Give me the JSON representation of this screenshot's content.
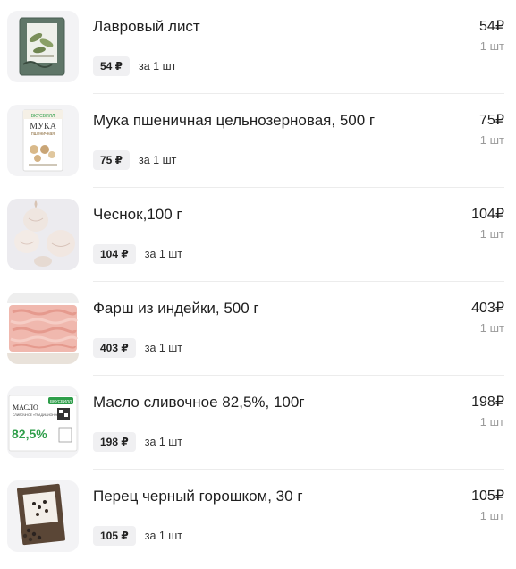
{
  "items": [
    {
      "name": "Лавровый лист",
      "unit_price": "54 ₽",
      "per_unit": "за 1 шт",
      "total": "54₽",
      "qty": "1 шт",
      "image": "bay-leaf-pack"
    },
    {
      "name": "Мука пшеничная цельнозерновая, 500 г",
      "unit_price": "75 ₽",
      "per_unit": "за 1 шт",
      "total": "75₽",
      "qty": "1 шт",
      "image": "flour-pack",
      "image_text": {
        "brand": "ВКУСВИЛЛ",
        "title": "МУКА",
        "subtitle": "пшеничная"
      }
    },
    {
      "name": "Чеснок,100 г",
      "unit_price": "104 ₽",
      "per_unit": "за 1 шт",
      "total": "104₽",
      "qty": "1 шт",
      "image": "garlic"
    },
    {
      "name": "Фарш из индейки, 500 г",
      "unit_price": "403 ₽",
      "per_unit": "за 1 шт",
      "total": "403₽",
      "qty": "1 шт",
      "image": "minced-turkey"
    },
    {
      "name": "Масло сливочное 82,5%, 100г",
      "unit_price": "198 ₽",
      "per_unit": "за 1 шт",
      "total": "198₽",
      "qty": "1 шт",
      "image": "butter-pack",
      "image_text": {
        "brand": "ВКУСВИЛЛ",
        "title": "МАСЛО",
        "subtitle": "СЛИВОЧНОЕ «ТРАДИЦИОННОЕ»",
        "percent": "82,5%"
      }
    },
    {
      "name": "Перец черный горошком, 30 г",
      "unit_price": "105 ₽",
      "per_unit": "за 1 шт",
      "total": "105₽",
      "qty": "1 шт",
      "image": "black-pepper-pack"
    }
  ],
  "colors": {
    "chip_bg": "#f0f0f2",
    "thumb_bg": "#f2f2f4",
    "brand_green": "#2e9e4a",
    "muted": "#9a9a9a"
  }
}
